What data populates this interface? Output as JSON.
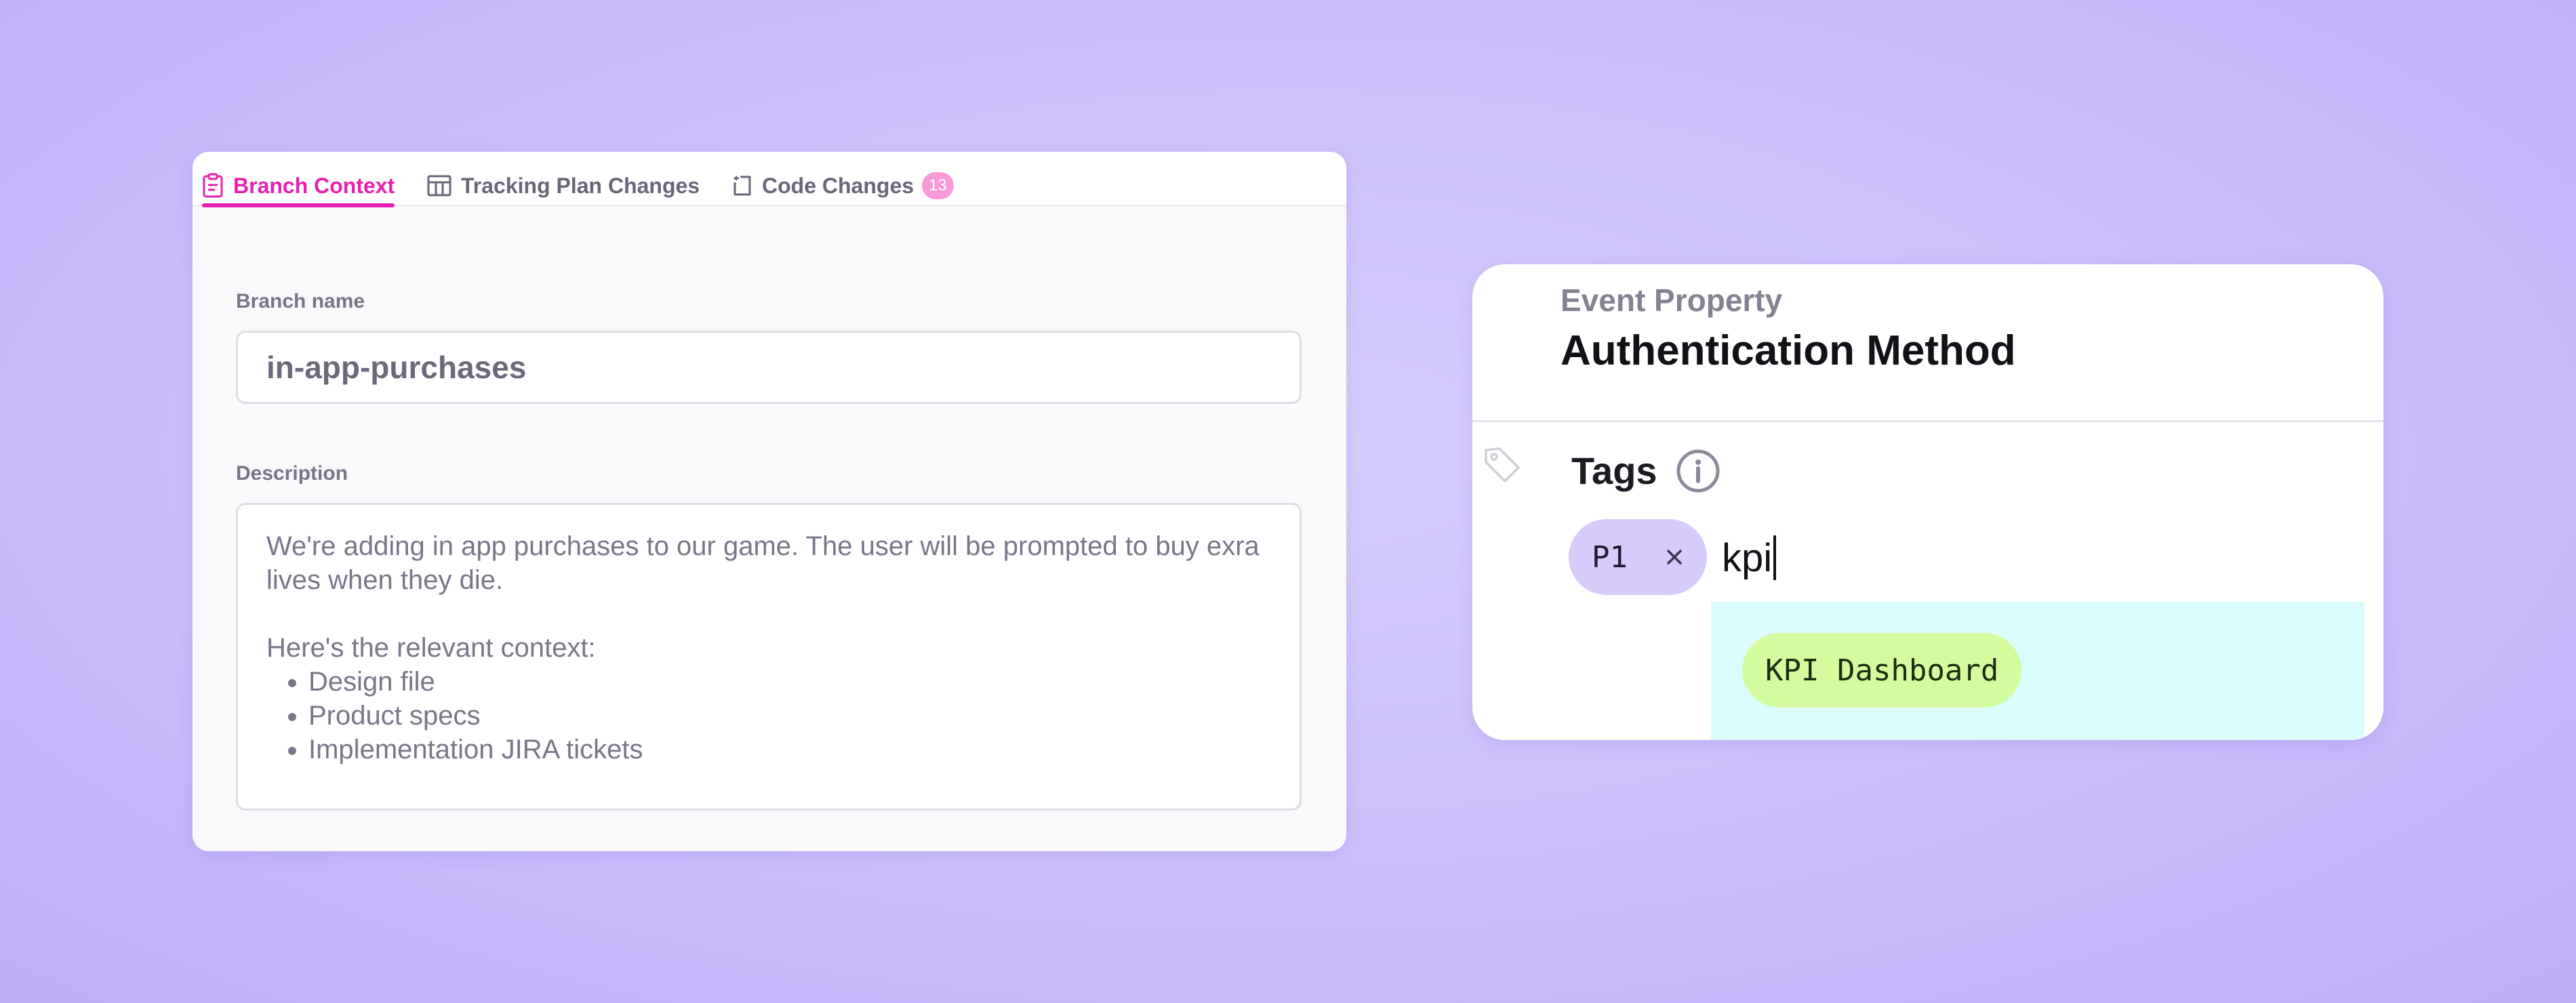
{
  "branch_panel": {
    "tabs": [
      {
        "label": "Branch Context",
        "icon": "clipboard-icon",
        "active": true
      },
      {
        "label": "Tracking Plan Changes",
        "icon": "table-icon",
        "active": false
      },
      {
        "label": "Code Changes",
        "icon": "code-branch-icon",
        "active": false,
        "badge": "13"
      }
    ],
    "branch_name_label": "Branch name",
    "branch_name_value": "in-app-purchases",
    "description_label": "Description",
    "description": {
      "paragraph1": "We're adding in app purchases to our game. The user will be prompted to buy exra lives when they die.",
      "paragraph2": "Here's the relevant context:",
      "bullets": [
        "Design file",
        "Product specs",
        "Implementation JIRA tickets"
      ]
    }
  },
  "property_panel": {
    "subtitle": "Event Property",
    "title": "Authentication Method",
    "tags_label": "Tags",
    "tag_chip": "P1",
    "tag_input_value": "kpi",
    "suggestions": [
      "KPI Dashboard"
    ]
  },
  "colors": {
    "accent_pink": "#e81fb0",
    "badge_pink": "#f79ad6",
    "chip_purple": "#d6cbfb",
    "suggestion_bg": "#dcfbfc",
    "suggestion_chip": "#d4fc9e",
    "background": "#cdc0fb"
  }
}
